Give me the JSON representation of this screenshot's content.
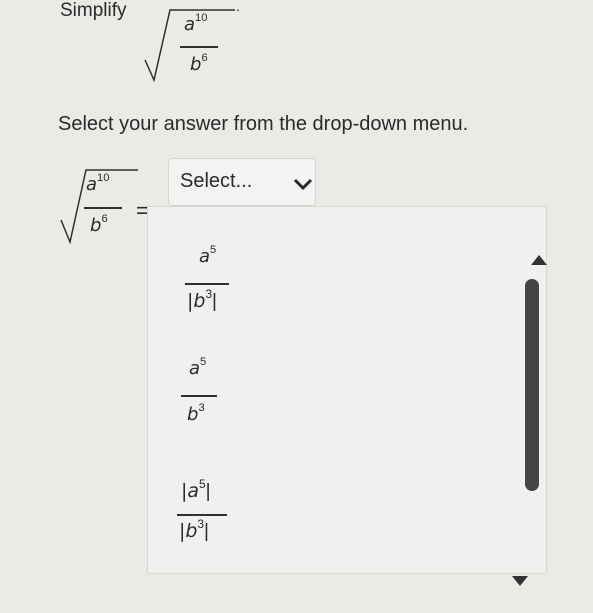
{
  "prompt": {
    "label": "Simplify",
    "expression": {
      "numerator_base": "a",
      "numerator_exp": "10",
      "denominator_base": "b",
      "denominator_exp": "6",
      "trailing": "."
    }
  },
  "instructions": "Select your answer from the drop-down menu.",
  "equation": {
    "numerator_base": "a",
    "numerator_exp": "10",
    "denominator_base": "b",
    "denominator_exp": "6",
    "equals": "="
  },
  "dropdown": {
    "selected_label": "Select...",
    "chevron_icon": "chevron-down-icon",
    "options": [
      {
        "numerator": "a",
        "numerator_exp": "5",
        "denominator": "|b",
        "denominator_exp": "3",
        "denominator_close": "|"
      },
      {
        "numerator": "a",
        "numerator_exp": "5",
        "denominator": "b",
        "denominator_exp": "3",
        "denominator_close": ""
      },
      {
        "numerator": "|a",
        "numerator_exp": "5",
        "numerator_close": "|",
        "denominator": "|b",
        "denominator_exp": "3",
        "denominator_close": "|"
      }
    ],
    "scroll_up_icon": "triangle-up-icon",
    "scroll_down_icon": "triangle-down-icon"
  },
  "colors": {
    "background": "#eceae6",
    "text": "#2a2a2a",
    "scroll_thumb": "#444444"
  }
}
